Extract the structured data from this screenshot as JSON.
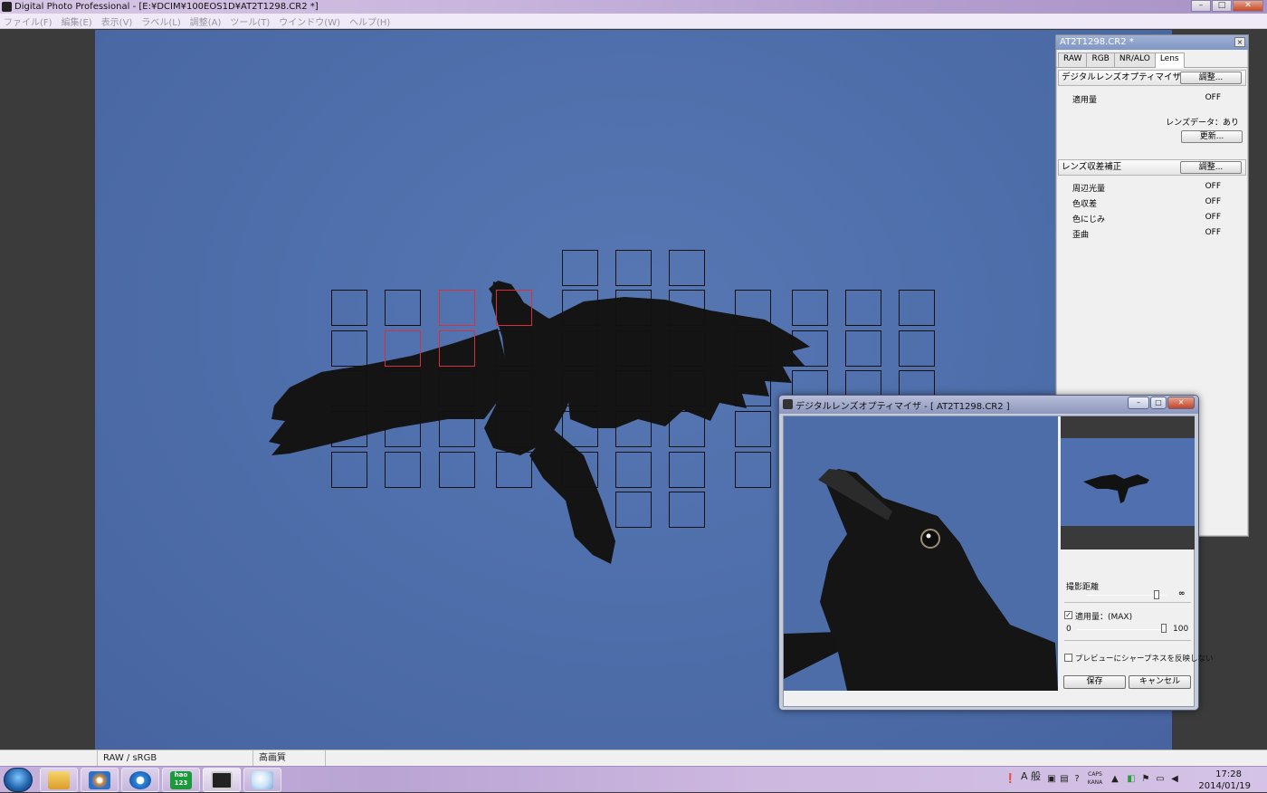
{
  "window": {
    "title": "Digital Photo Professional - [E:¥DCIM¥100EOS1D¥AT2T1298.CR2 *]",
    "buttons": {
      "minimize": "–",
      "maximize": "□",
      "close": "✕"
    }
  },
  "menu": [
    "ファイル(F)",
    "編集(E)",
    "表示(V)",
    "ラベル(L)",
    "調整(A)",
    "ツール(T)",
    "ウインドウ(W)",
    "ヘルプ(H)"
  ],
  "status": {
    "color_mode": "RAW / sRGB",
    "quality": "高画質"
  },
  "palette": {
    "title": "AT2T1298.CR2 *",
    "close": "×",
    "tabs": [
      "RAW",
      "RGB",
      "NR/ALO",
      "Lens"
    ],
    "active_tab": "Lens",
    "dlo_section": {
      "label": "デジタルレンズオプティマイザ",
      "button": "調整...",
      "amount_label": "適用量",
      "amount_value": "OFF",
      "lens_data": "レンズデータ：あり",
      "update_button": "更新..."
    },
    "aberration_section": {
      "label": "レンズ収差補正",
      "button": "調整...",
      "rows": [
        {
          "label": "周辺光量",
          "value": "OFF"
        },
        {
          "label": "色収差",
          "value": "OFF"
        },
        {
          "label": "色にじみ",
          "value": "OFF"
        },
        {
          "label": "歪曲",
          "value": "OFF"
        }
      ]
    }
  },
  "dlo_dialog": {
    "title": "デジタルレンズオプティマイザ - [ AT2T1298.CR2 ]",
    "distance_label": "撮影距離",
    "distance_max": "∞",
    "amount_checkbox_label": "適用量：(MAX)",
    "amount_checked": true,
    "slider_min": "0",
    "slider_max": "100",
    "sharpness_checkbox_label": "プレビューにシャープネスを反映しない",
    "sharpness_checked": false,
    "save_button": "保存",
    "cancel_button": "キャンセル",
    "buttons": {
      "minimize": "–",
      "maximize": "□",
      "close": "✕"
    }
  },
  "taskbar": {
    "apps": [
      "explorer-icon",
      "media-player-icon",
      "ie-icon",
      "hao123-icon",
      "dpp-icon",
      "paint-icon"
    ],
    "hao_label": "hao 123",
    "tray": {
      "ime": "A 般",
      "caps": "CAPS",
      "kana": "KANA"
    },
    "time": "17:28",
    "date": "2014/01/19"
  },
  "colors": {
    "af_selected": "#d8303a",
    "af_point": "#111111",
    "sky": "#4e6fab"
  }
}
